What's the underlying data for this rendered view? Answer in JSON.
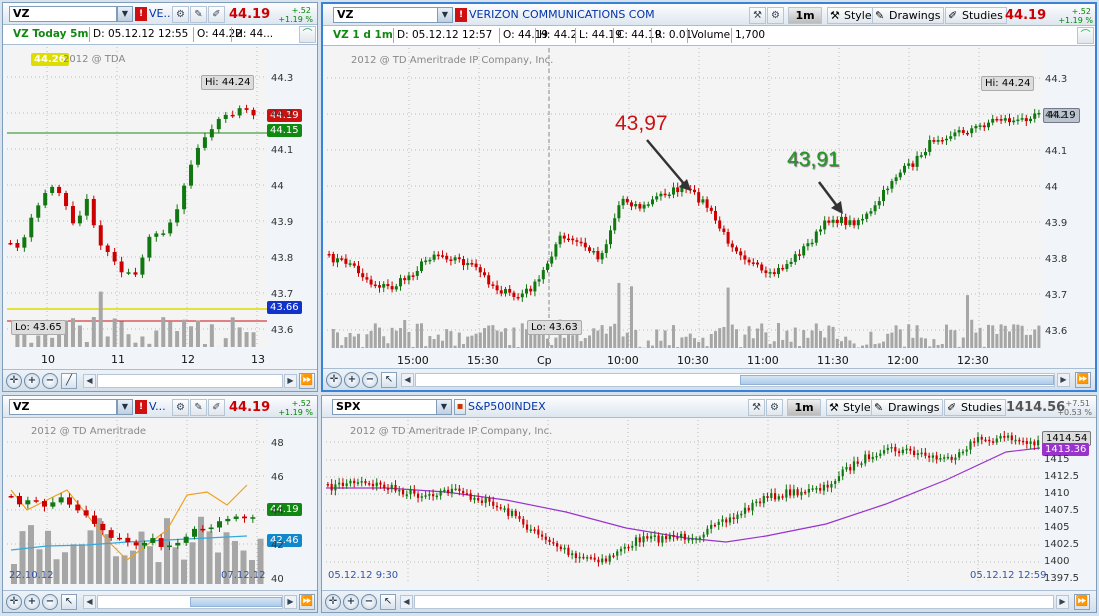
{
  "colors": {
    "up": "#117711",
    "down": "#cc0000",
    "vol": "#999999",
    "accent": "#3a82d8"
  },
  "icons": [
    "dropdown-arrow-icon",
    "wrench-icon",
    "plug-icon",
    "pencil-icon",
    "pin-icon",
    "draw-icon",
    "style-icon",
    "studies-icon",
    "zoom-in-icon",
    "zoom-out-icon",
    "pan-icon",
    "crosshair-icon",
    "scroll-left-icon",
    "scroll-right-icon",
    "expand-icon"
  ],
  "tl": {
    "symbol": "VZ",
    "badge": "!",
    "desc": "VE...",
    "price": "44.19",
    "chg": "+.52",
    "chg_pct": "+1.19 %",
    "info": {
      "title": "VZ Today 5m",
      "d": "D: 05.12.12 12:55",
      "o": "O: 44.22",
      "h": "H: 44..."
    },
    "copyright": "2012 @ TDA",
    "last_tag": "44.26",
    "hi": "Hi: 44.24",
    "lo": "Lo: 43.65",
    "tags": {
      "red": "44.19",
      "green": "44.15",
      "blue": "43.66"
    },
    "yticks": [
      "44.3",
      "44.2",
      "44.1",
      "44",
      "43.9",
      "43.8",
      "43.7",
      "43.6"
    ],
    "xticks": [
      "10",
      "11",
      "12",
      "13"
    ]
  },
  "tr": {
    "symbol": "VZ",
    "badge": "!",
    "desc": "VERIZON COMMUNICATIONS COM",
    "agg": "1m",
    "style": "Style",
    "drawings": "Drawings",
    "studies": "Studies",
    "price": "44.19",
    "chg": "+.52",
    "chg_pct": "+1.19 %",
    "info": {
      "title": "VZ 1 d 1m",
      "d": "D: 05.12.12 12:57",
      "o": "O: 44.19",
      "h": "H: 44.2",
      "l": "L: 44.19",
      "c": "C: 44.19",
      "r": "R: 0.01",
      "vol": "Volume",
      "volv": "1,700"
    },
    "copyright": "2012 @ TD Ameritrade IP Company, Inc.",
    "hi": "Hi: 44.24",
    "lo": "Lo: 43.63",
    "tag": "44.19",
    "ann1": "43,97",
    "ann2": "43,91",
    "yticks": [
      "44.3",
      "44.2",
      "44.1",
      "44",
      "43.9",
      "43.8",
      "43.7",
      "43.6"
    ],
    "xticks": [
      "15:00",
      "15:30",
      "Cp",
      "10:00",
      "10:30",
      "11:00",
      "11:30",
      "12:00",
      "12:30"
    ]
  },
  "bl": {
    "symbol": "VZ",
    "badge": "!",
    "desc": "V...",
    "price": "44.19",
    "chg": "+.52",
    "chg_pct": "+1.19 %",
    "copyright": "2012 @ TD Ameritrade",
    "tags": {
      "green": "44.19",
      "blue": "42.46"
    },
    "yticks": [
      "48",
      "46",
      "44",
      "42",
      "40"
    ],
    "date_start": "22.10.12",
    "date_end": "07.12.12"
  },
  "br": {
    "symbol": "SPX",
    "desc": "S&P500INDEX",
    "agg": "1m",
    "style": "Style",
    "drawings": "Drawings",
    "studies": "Studies",
    "price": "1414.56",
    "chg": "+7.51",
    "chg_pct": "+0.53 %",
    "copyright": "2012 @ TD Ameritrade IP Company, Inc.",
    "tags": {
      "price": "1414.54",
      "ma": "1413.36"
    },
    "yticks": [
      "1415",
      "1412.5",
      "1410",
      "1407.5",
      "1405",
      "1402.5",
      "1400",
      "1397.5"
    ],
    "date_start": "05.12.12 9:30",
    "date_end": "05.12.12 12:59"
  }
}
